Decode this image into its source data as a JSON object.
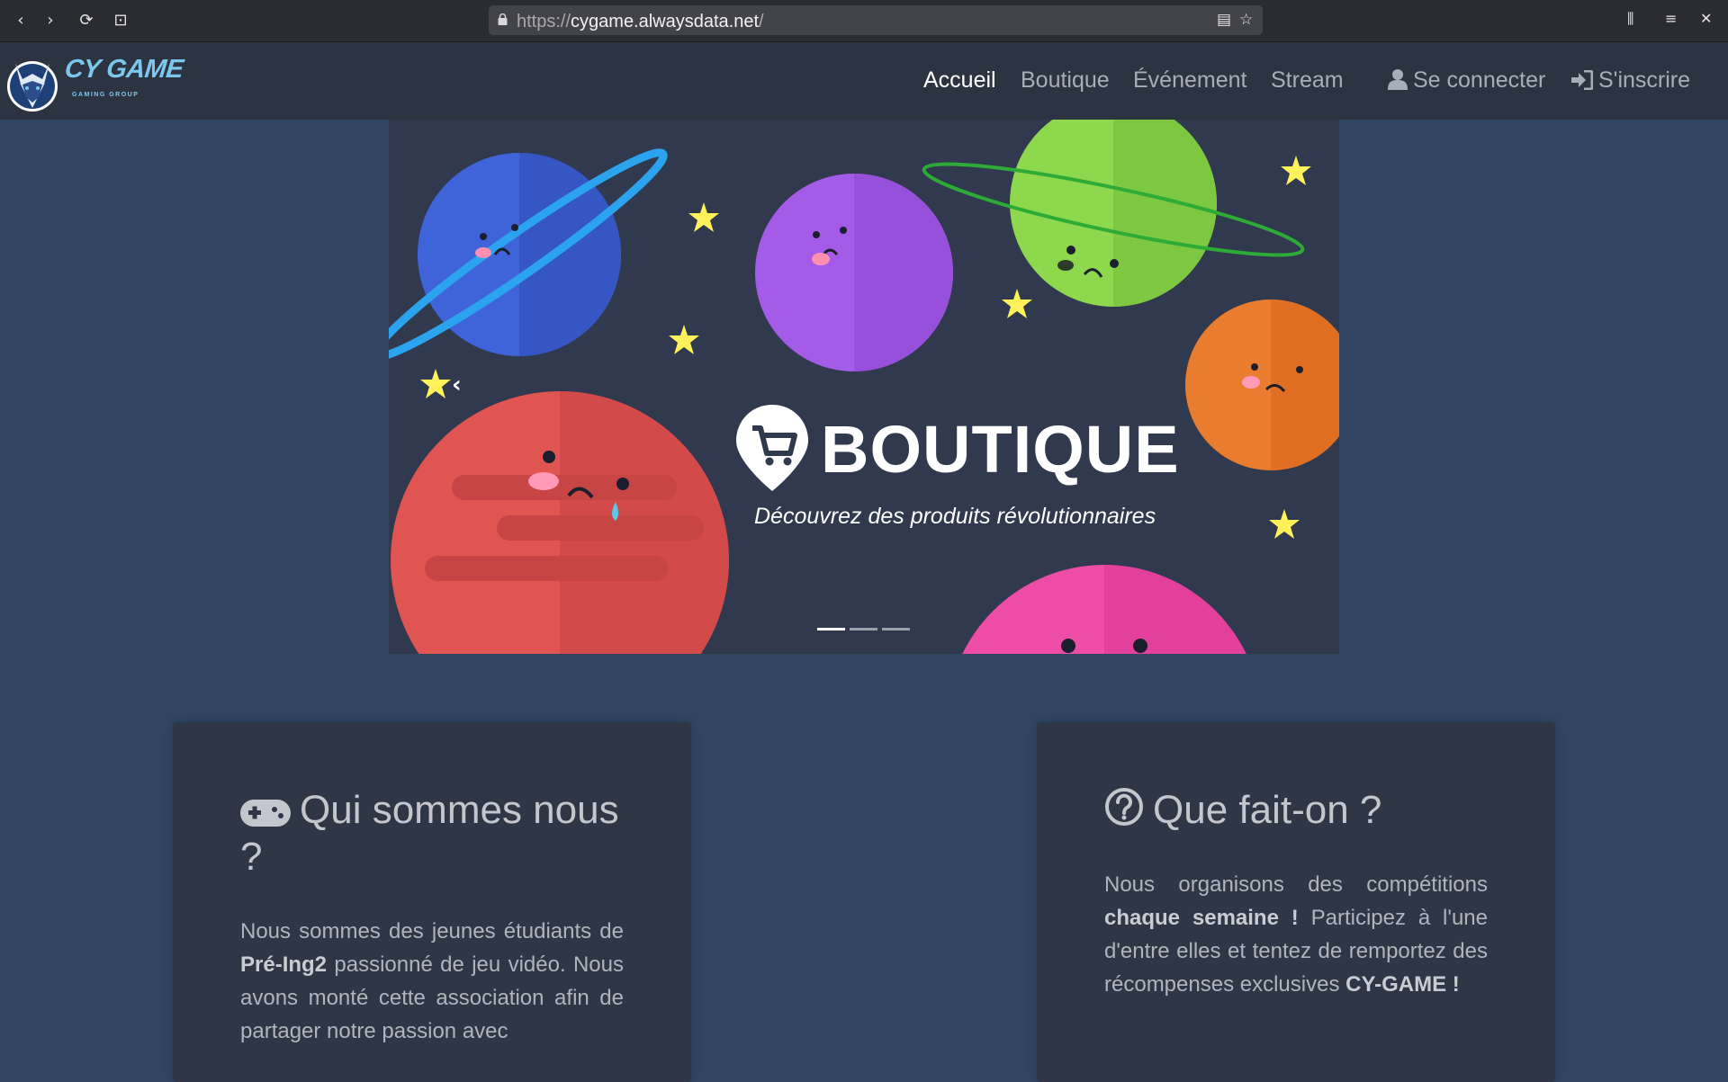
{
  "browser": {
    "url_prefix": "https://",
    "url_host": "cygame.alwaysdata.net",
    "url_suffix": "/",
    "icons": [
      "back-icon",
      "forward-icon",
      "reload-icon",
      "screenshot-icon",
      "lock-icon",
      "reader-icon",
      "bookmark-star-icon",
      "library-icon",
      "menu-icon",
      "close-icon"
    ]
  },
  "site": {
    "brand": "CY GAME",
    "brand_sub": "GAMING GROUP",
    "nav": [
      {
        "label": "Accueil",
        "active": true
      },
      {
        "label": "Boutique",
        "active": false
      },
      {
        "label": "Événement",
        "active": false
      },
      {
        "label": "Stream",
        "active": false
      }
    ],
    "login_label": "Se connecter",
    "register_label": "S'inscrire"
  },
  "carousel": {
    "title": "BOUTIQUE",
    "subtitle": "Découvrez des produits révolutionnaires",
    "active_slide": 1,
    "slide_count": 3
  },
  "cards": {
    "about": {
      "title": "Qui sommes nous ?",
      "text_1": "Nous sommes des jeunes étudiants de ",
      "text_bold": "Pré-Ing2",
      "text_2": " passionné de jeu vidéo. Nous avons monté cette association afin de partager notre passion avec"
    },
    "what": {
      "title": "Que fait-on ?",
      "text_1": "Nous organisons des compétitions ",
      "text_bold_1": "chaque semaine !",
      "text_2": " Participez à l'une d'entre elles et tentez de remportez des récompenses exclusives ",
      "text_bold_2": "CY-GAME !"
    }
  },
  "colors": {
    "page_bg": "#2f4560",
    "nav_bg": "#2d3441",
    "card_bg": "#2f3747",
    "brand": "#7cc7ee"
  }
}
